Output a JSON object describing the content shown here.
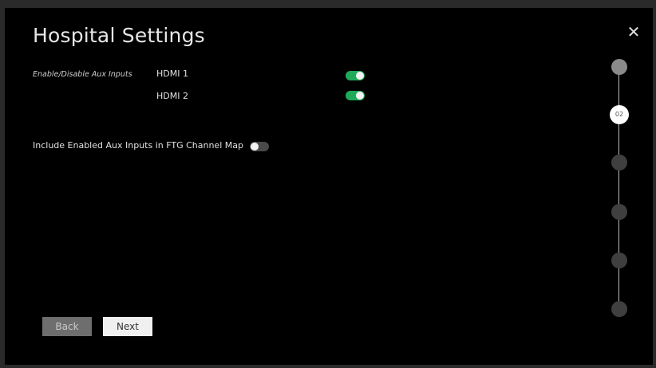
{
  "page": {
    "title": "Hospital Settings",
    "close_glyph": "✕"
  },
  "aux_inputs": {
    "label": "Enable/Disable Aux Inputs",
    "items": [
      {
        "name": "HDMI 1",
        "enabled": true
      },
      {
        "name": "HDMI 2",
        "enabled": true
      }
    ]
  },
  "channel_map": {
    "label": "Include Enabled Aux Inputs in FTG Channel Map",
    "enabled": false
  },
  "buttons": {
    "back_label": "Back",
    "next_label": "Next"
  },
  "stepper": {
    "current_label": "02",
    "total_steps": 6,
    "current_step": 2
  },
  "colors": {
    "toggle_on": "#1faa5a",
    "toggle_off": "#4a4a4a",
    "background": "#000000"
  },
  "icons": {
    "close": "close-icon",
    "toggle": "toggle-switch"
  }
}
